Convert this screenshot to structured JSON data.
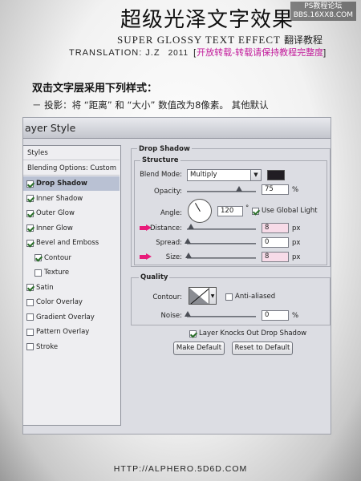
{
  "header": {
    "title_cn": "超级光泽文字效果",
    "watermark_line1": "PS教程论坛",
    "watermark_line2": "BBS.16XX8.COM",
    "subtitle_en": "SUPER GLOSSY TEXT EFFECT",
    "subtitle_cn": "翻译教程",
    "translation": "TRANSLATION: J.Z",
    "year": "2011",
    "bracket_open": "[",
    "reprint_note": "开放转载-转载请保持教程完整度",
    "bracket_close": "]"
  },
  "instructions": {
    "line1": "双击文字层采用下列样式：",
    "line2": "－ 投影：将 “距离” 和 “大小” 数值改为8像素。 其他默认"
  },
  "dialog": {
    "title": "ayer Style",
    "sidebar": {
      "styles": "Styles",
      "blending": "Blending Options: Custom",
      "items": [
        {
          "label": "Drop Shadow",
          "checked": true,
          "selected": true
        },
        {
          "label": "Inner Shadow",
          "checked": true
        },
        {
          "label": "Outer Glow",
          "checked": true
        },
        {
          "label": "Inner Glow",
          "checked": true
        },
        {
          "label": "Bevel and Emboss",
          "checked": true
        },
        {
          "label": "Contour",
          "checked": true
        },
        {
          "label": "Texture",
          "checked": false
        },
        {
          "label": "Satin",
          "checked": true
        },
        {
          "label": "Color Overlay",
          "checked": false
        },
        {
          "label": "Gradient Overlay",
          "checked": false
        },
        {
          "label": "Pattern Overlay",
          "checked": false
        },
        {
          "label": "Stroke",
          "checked": false
        }
      ]
    },
    "drop_shadow": {
      "title": "Drop Shadow",
      "structure": {
        "title": "Structure",
        "blend_mode_label": "Blend Mode:",
        "blend_mode_value": "Multiply",
        "shadow_color": "#211d23",
        "opacity_label": "Opacity:",
        "opacity_value": "75",
        "opacity_level": 0.75,
        "percent": "%",
        "angle_label": "Angle:",
        "angle_value": "120",
        "degree": "°",
        "global_light_label": "Use Global Light",
        "global_light_checked": true,
        "distance_label": "Distance:",
        "distance_value": "8",
        "spread_label": "Spread:",
        "spread_value": "0",
        "size_label": "Size:",
        "size_value": "8",
        "px": "px"
      },
      "quality": {
        "title": "Quality",
        "contour_label": "Contour:",
        "anti_aliased_label": "Anti-aliased",
        "anti_aliased_checked": false,
        "noise_label": "Noise:",
        "noise_value": "0",
        "percent": "%"
      },
      "knocks_out_label": "Layer Knocks Out Drop Shadow",
      "knocks_out_checked": true,
      "make_default": "Make Default",
      "reset_default": "Reset to Default"
    }
  },
  "footer": {
    "url": "HTTP://ALPHERO.5D6D.COM"
  },
  "colors": {
    "highlight_arrow": "#e81b7a",
    "note_text": "#c2189a"
  }
}
